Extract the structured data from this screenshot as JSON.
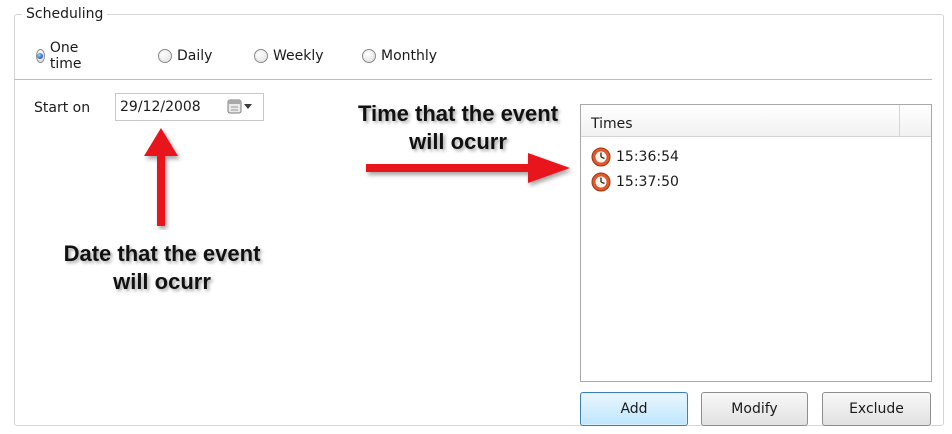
{
  "scheduling": {
    "title": "Scheduling",
    "frequency": {
      "selected": "One time",
      "options": [
        "One time",
        "Daily",
        "Weekly",
        "Monthly"
      ]
    },
    "start_on": {
      "label": "Start on",
      "value": "29/12/2008"
    }
  },
  "times": {
    "header": "Times",
    "items": [
      "15:36:54",
      "15:37:50"
    ]
  },
  "buttons": {
    "add": "Add",
    "modify": "Modify",
    "exclude": "Exclude"
  },
  "annotations": {
    "date_note_line1": "Date that the event",
    "date_note_line2": "will ocurr",
    "time_note_line1": "Time that the event",
    "time_note_line2": "will ocurr"
  },
  "colors": {
    "arrow": "#e8141b",
    "accent_radio": "#2a6fc4",
    "clock": "#d9542b"
  },
  "icons": [
    "calendar-icon",
    "chevron-down-icon",
    "clock-icon"
  ]
}
